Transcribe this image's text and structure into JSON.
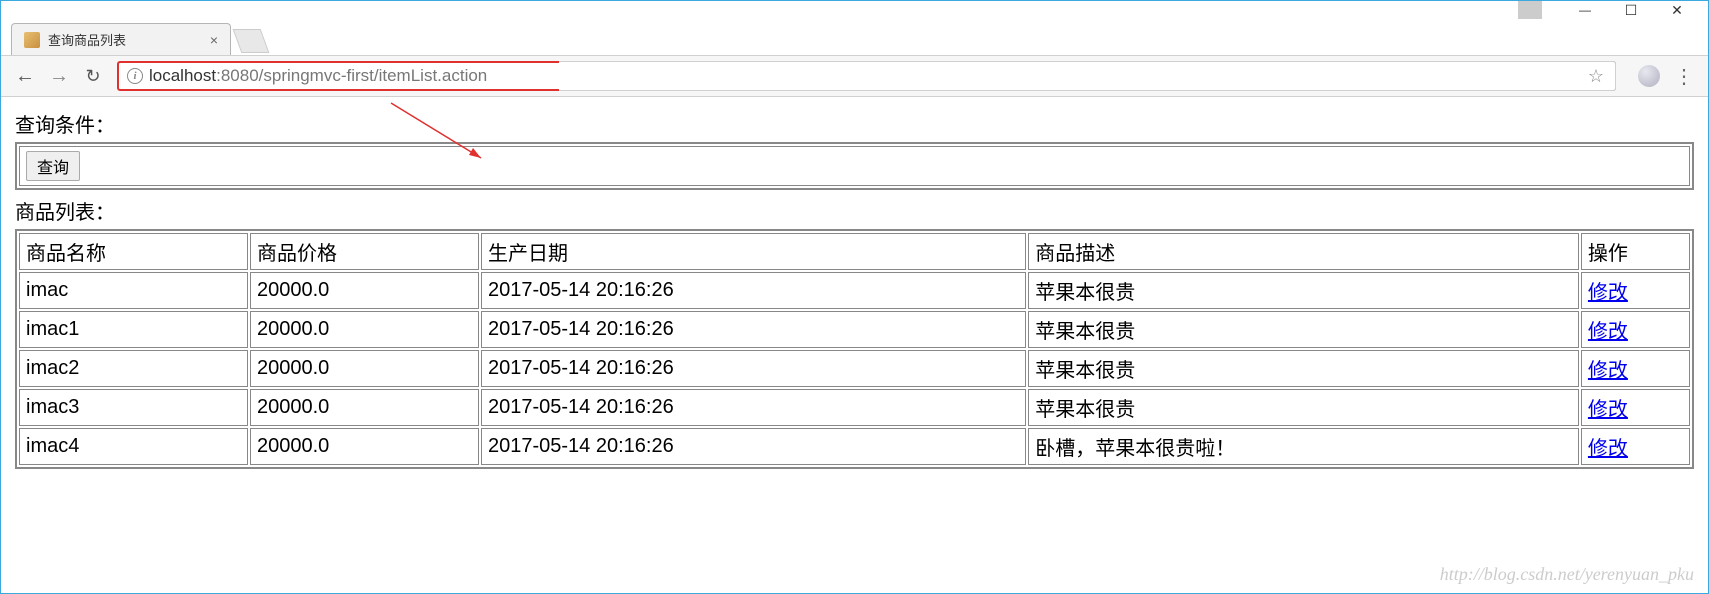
{
  "window": {
    "tab_title": "查询商品列表"
  },
  "browser": {
    "url_host": "localhost",
    "url_port_path": ":8080/springmvc-first/itemList.action"
  },
  "page": {
    "query_label": "查询条件：",
    "query_button": "查询",
    "list_label": "商品列表：",
    "headers": {
      "name": "商品名称",
      "price": "商品价格",
      "date": "生产日期",
      "desc": "商品描述",
      "action": "操作"
    },
    "action_link": "修改",
    "items": [
      {
        "name": "imac",
        "price": "20000.0",
        "date": "2017-05-14 20:16:26",
        "desc": "苹果本很贵"
      },
      {
        "name": "imac1",
        "price": "20000.0",
        "date": "2017-05-14 20:16:26",
        "desc": "苹果本很贵"
      },
      {
        "name": "imac2",
        "price": "20000.0",
        "date": "2017-05-14 20:16:26",
        "desc": "苹果本很贵"
      },
      {
        "name": "imac3",
        "price": "20000.0",
        "date": "2017-05-14 20:16:26",
        "desc": "苹果本很贵"
      },
      {
        "name": "imac4",
        "price": "20000.0",
        "date": "2017-05-14 20:16:26",
        "desc": "卧槽，苹果本很贵啦！"
      }
    ]
  },
  "watermark": "http://blog.csdn.net/yerenyuan_pku"
}
